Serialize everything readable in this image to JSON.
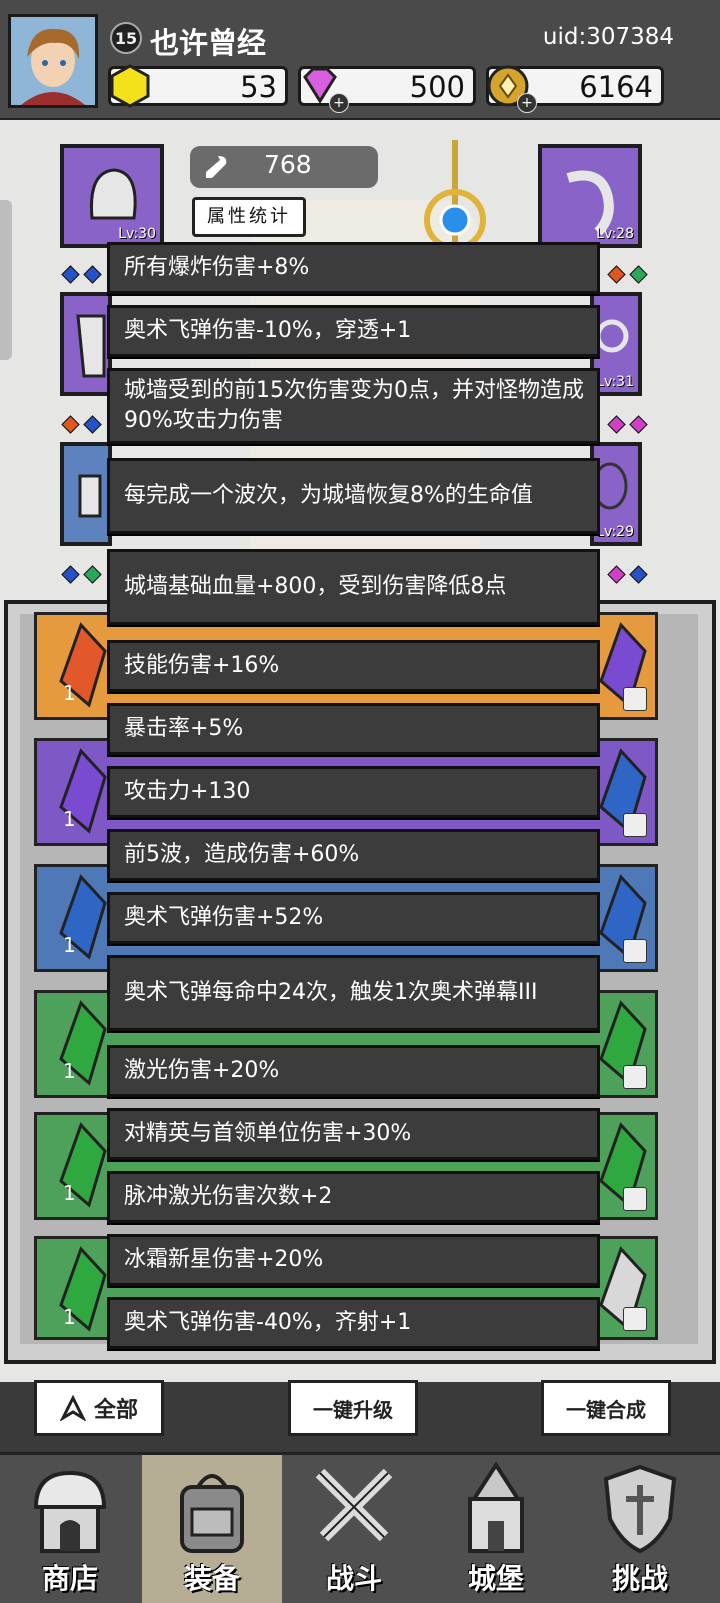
{
  "player": {
    "level": "15",
    "name": "也许曾经",
    "uid": "uid:307384"
  },
  "currency": {
    "gold_gem": "53",
    "diamond": "500",
    "coin": "6164"
  },
  "equip": {
    "power": "768",
    "stat_button": "属性统计",
    "slots": [
      {
        "level": "Lv:30"
      },
      {
        "level": "Lv:28"
      },
      {
        "level": ""
      },
      {
        "level": "Lv:31"
      },
      {
        "level": ""
      },
      {
        "level": "Lv:29"
      }
    ]
  },
  "tooltip": {
    "lines": [
      "所有爆炸伤害+8%",
      "奥术飞弹伤害-10%，穿透+1",
      "城墙受到的前15次伤害变为0点，并对怪物造成90%攻击力伤害",
      "每完成一个波次，为城墙恢复8%的生命值",
      "城墙基础血量+800，受到伤害降低8点",
      "技能伤害+16%",
      "暴击率+5%",
      "攻击力+130",
      "前5波，造成伤害+60%",
      "奥术飞弹伤害+52%",
      "奥术飞弹每命中24次，触发1次奥术弹幕III",
      "激光伤害+20%",
      "对精英与首领单位伤害+30%",
      "脉冲激光伤害次数+2",
      "冰霜新星伤害+20%",
      "奥术飞弹伤害-40%，齐射+1"
    ]
  },
  "inventory": {
    "row_counts": [
      "1",
      "1",
      "1",
      "1",
      "1",
      "1"
    ]
  },
  "buttons": {
    "all": "全部",
    "upgrade_all": "一键升级",
    "merge_all": "一键合成"
  },
  "nav": {
    "shop": "商店",
    "equipment": "装备",
    "battle": "战斗",
    "castle": "城堡",
    "challenge": "挑战"
  },
  "colors": {
    "purple_slot": "#8a63c9",
    "blue_slot": "#5d82bd",
    "active_tab": "#b6ad95"
  }
}
